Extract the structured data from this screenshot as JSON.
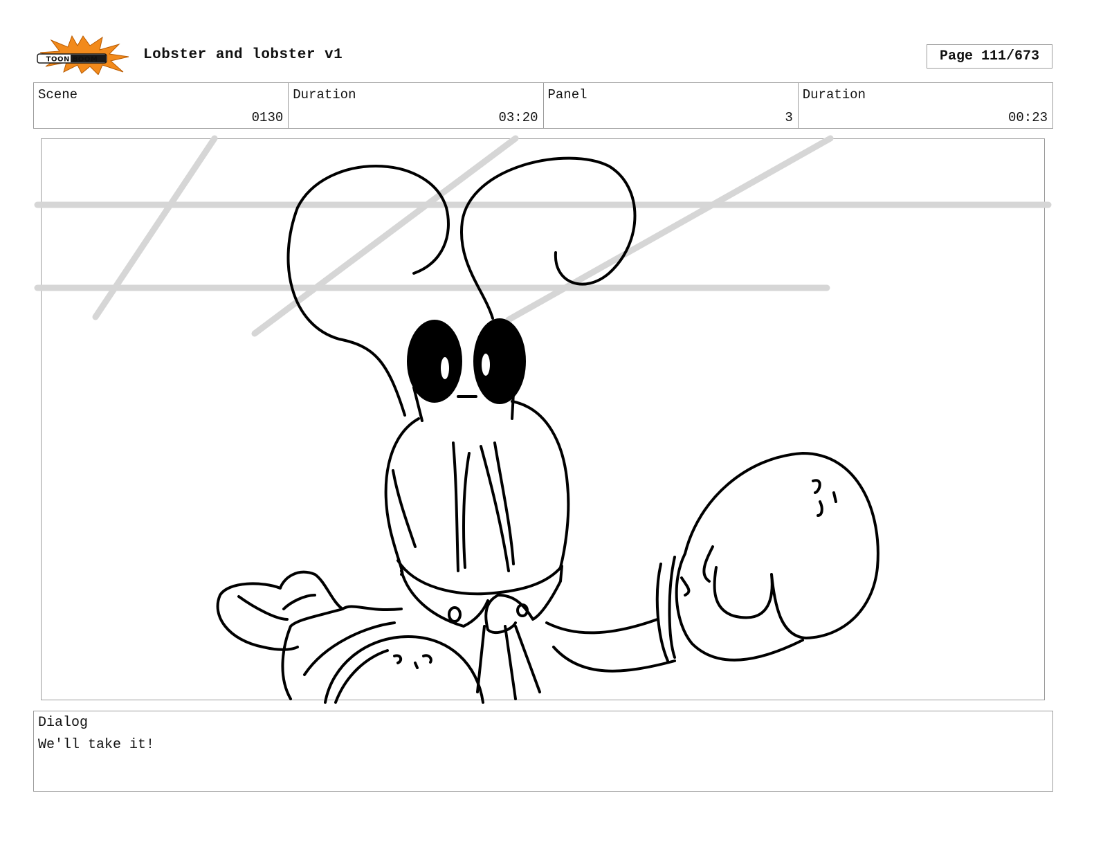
{
  "header": {
    "logo_text": "TOON BOOM",
    "title": "Lobster and lobster v1",
    "page": "Page 111/673"
  },
  "info": {
    "scene_label": "Scene",
    "scene_value": "0130",
    "scene_duration_label": "Duration",
    "scene_duration_value": "03:20",
    "panel_label": "Panel",
    "panel_value": "3",
    "panel_duration_label": "Duration",
    "panel_duration_value": "00:23"
  },
  "dialog": {
    "label": "Dialog",
    "text": "We'll take it!"
  },
  "colors": {
    "logo_burst": "#f28a1b",
    "logo_band": "#1a1a1a",
    "frame_border": "#9a9a9a",
    "guide_lines": "#d6d6d6"
  }
}
